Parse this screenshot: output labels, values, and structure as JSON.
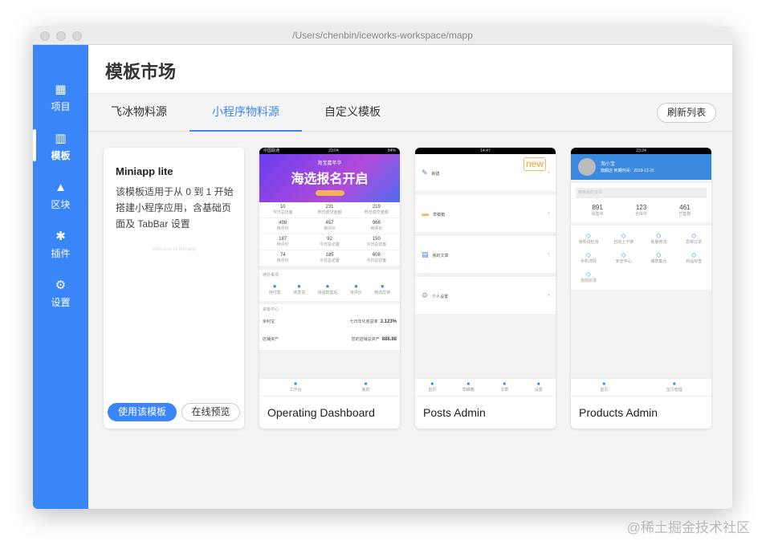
{
  "window": {
    "title": "/Users/chenbin/iceworks-workspace/mapp"
  },
  "sidebar": {
    "items": [
      {
        "label": "项目",
        "icon": "grid-icon"
      },
      {
        "label": "模板",
        "icon": "template-icon",
        "active": true
      },
      {
        "label": "区块",
        "icon": "blocks-icon"
      },
      {
        "label": "插件",
        "icon": "puzzle-icon"
      },
      {
        "label": "设置",
        "icon": "gear-icon"
      }
    ]
  },
  "header": {
    "title": "模板市场"
  },
  "tabs": [
    {
      "label": "飞冰物料源"
    },
    {
      "label": "小程序物料源",
      "active": true
    },
    {
      "label": "自定义模板"
    }
  ],
  "refresh_label": "刷新列表",
  "accent": "#3a85f7",
  "cards": {
    "lite": {
      "title": "Miniapp lite",
      "desc": "该模板适用于从 0 到 1 开始搭建小程序应用，含基础页面及 TabBar 设置",
      "watermark": "Welcome to Miniapp",
      "use": "使用该模板",
      "preview": "在线预览"
    },
    "dashboard": {
      "name": "Operating Dashboard",
      "status_time": "23:04",
      "status_carrier": "中国联通",
      "status_battery": "84%",
      "banner_top": "淘宝嘉年华",
      "banner": "海选报名开启",
      "stats": [
        [
          "10",
          "今日总访客"
        ],
        [
          "231",
          "昨日成交金额"
        ],
        [
          "219",
          "昨日成交金额"
        ],
        [
          "498",
          "待评价"
        ],
        [
          "457",
          "待评价"
        ],
        [
          "966",
          "待评价"
        ],
        [
          "187",
          "待评价"
        ],
        [
          "92",
          "今日总访客"
        ],
        [
          "150",
          "今日总访客"
        ],
        [
          "74",
          "待评价"
        ],
        [
          "185",
          "今日总访客"
        ],
        [
          "608",
          "今日总访客"
        ]
      ],
      "todo_title": "待办事项",
      "todos": [
        "待付款",
        "待发货",
        "待退款售后",
        "待评价",
        "物流异常"
      ],
      "fund_title": "资金中心",
      "funds": [
        [
          "余利宝",
          "七日年化收益率",
          "3.123%"
        ],
        [
          "店铺资产",
          "您的店铺总资产",
          "888.88"
        ]
      ],
      "tabs": [
        "工作台",
        "我的"
      ]
    },
    "posts": {
      "name": "Posts Admin",
      "badge": "new",
      "status_time": "14:47",
      "items": [
        "新建",
        "草稿箱",
        "我的文章",
        "个人设置"
      ],
      "tabs": [
        "首页",
        "草稿箱",
        "文章",
        "设置"
      ]
    },
    "products": {
      "name": "Products Admin",
      "status_time": "23:34",
      "user": "淘小宝",
      "user_sub": "旗舰店  到期时间：2019-12-21",
      "search": "搜索我的宝贝",
      "stats": [
        [
          "891",
          "出售中"
        ],
        [
          "123",
          "仓库中"
        ],
        [
          "461",
          "已售罄"
        ]
      ],
      "grid": [
        "违规词检测",
        "自动上下架",
        "批量修改",
        "异常订单",
        "手机详情",
        "安全中心",
        "爆款集合",
        "商品标签",
        "违规反馈"
      ],
      "tabs": [
        "首页",
        "宝贝管理"
      ]
    }
  },
  "watermark": "@稀土掘金技术社区"
}
